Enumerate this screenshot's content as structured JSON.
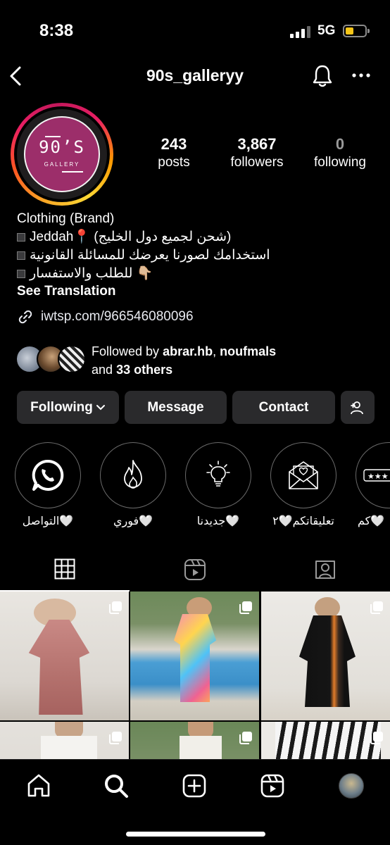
{
  "status_bar": {
    "time": "8:38",
    "network": "5G",
    "battery_color": "#f5c518"
  },
  "header": {
    "username": "90s_galleryy"
  },
  "profile": {
    "avatar_text": "90’S",
    "avatar_subtext": "GALLERY",
    "stats": [
      {
        "value": "243",
        "label": "posts"
      },
      {
        "value": "3,867",
        "label": "followers"
      },
      {
        "value": "0",
        "label": "following"
      }
    ],
    "category": "Clothing (Brand)",
    "bio_lines": [
      "Jeddah📍 (شحن لجميع دول الخليج)",
      "استخدامك لصورنا يعرضك للمسائلة القانونية",
      "للطلب والاستفسار 👇🏼"
    ],
    "see_translation": "See Translation",
    "link": "iwtsp.com/966546080096",
    "followed_by": {
      "prefix": "Followed by",
      "user1": "abrar.hb",
      "sep": ",",
      "user2": "noufmals",
      "and": "and",
      "others": "33 others"
    }
  },
  "buttons": {
    "following": "Following",
    "message": "Message",
    "contact": "Contact"
  },
  "highlights": [
    {
      "label": "التواصل🤍",
      "icon": "whatsapp-icon"
    },
    {
      "label": "فوري🤍",
      "icon": "fire-icon"
    },
    {
      "label": "جديدنا🤍",
      "icon": "lightbulb-icon"
    },
    {
      "label": "تعليقاتكم🤍٢",
      "icon": "envelope-heart-icon"
    },
    {
      "label": "كم🤍",
      "icon": "rating-stars-icon"
    }
  ],
  "tabs": [
    "grid-icon",
    "reels-icon",
    "tagged-icon"
  ],
  "colors": {
    "accent_ring": "#e91e63",
    "button_bg": "#2a2a2c",
    "avatar_bg": "#9c2e6a"
  }
}
